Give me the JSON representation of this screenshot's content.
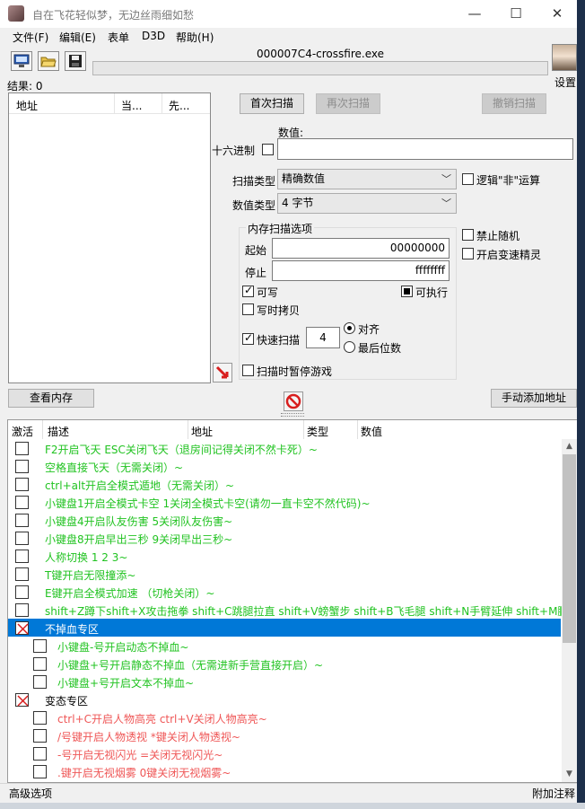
{
  "window": {
    "title": "自在飞花轻似梦，无边丝雨细如愁",
    "minimize_glyph": "—",
    "maximize_glyph": "☐",
    "close_glyph": "✕"
  },
  "menu": {
    "file": "文件(F)",
    "edit": "编辑(E)",
    "table": "表单",
    "d3d": "D3D",
    "help": "帮助(H)"
  },
  "toolbar": {
    "process_name": "000007C4-crossfire.exe",
    "settings_label": "设置",
    "icons": [
      "computer-icon",
      "open-folder-icon",
      "save-disk-icon"
    ]
  },
  "results": {
    "label": "结果: 0"
  },
  "address_list": {
    "headers": [
      "地址",
      "当...",
      "先..."
    ]
  },
  "scan": {
    "first_scan": "首次扫描",
    "next_scan": "再次扫描",
    "undo_scan": "撤销扫描",
    "value_label": "数值:",
    "hex_label": "十六进制",
    "value_input": "",
    "scan_type_label": "扫描类型",
    "scan_type_value": "精确数值",
    "value_type_label": "数值类型",
    "value_type_value": "4 字节",
    "logic_not": "逻辑\"非\"运算",
    "disable_random": "禁止随机",
    "speedhack": "开启变速精灵"
  },
  "memory_options": {
    "title": "内存扫描选项",
    "start_label": "起始",
    "start_value": "00000000",
    "stop_label": "停止",
    "stop_value": "ffffffff",
    "writable": "可写",
    "executable": "可执行",
    "copy_on_write": "写时拷贝",
    "fast_scan": "快速扫描",
    "fast_scan_value": "4",
    "align": "对齐",
    "last_digits": "最后位数",
    "pause_game": "扫描时暂停游戏"
  },
  "actions": {
    "view_memory": "查看内存",
    "add_address": "手动添加地址"
  },
  "cheat_table": {
    "headers": [
      "激活",
      "描述",
      "地址",
      "类型",
      "数值"
    ],
    "rows": [
      {
        "text": "F2开启飞天 ESC关闭飞天（退房间记得关闭不然卡死）~",
        "color": "green"
      },
      {
        "text": "空格直接飞天（无需关闭）~",
        "color": "green"
      },
      {
        "text": "ctrl+alt开启全模式遁地（无需关闭）~",
        "color": "green"
      },
      {
        "text": "小键盘1开启全模式卡空 1关闭全模式卡空(请勿一直卡空不然代码)~",
        "color": "green"
      },
      {
        "text": "小键盘4开启队友伤害  5关闭队友伤害~",
        "color": "green"
      },
      {
        "text": "小键盘8开启早出三秒 9关闭早出三秒~",
        "color": "green"
      },
      {
        "text": "人称切换 1 2 3~",
        "color": "green"
      },
      {
        "text": "T键开启无限撞添~",
        "color": "green"
      },
      {
        "text": "E键开启全模式加速 （切枪关闭）~",
        "color": "green"
      },
      {
        "text": "shift+Z蹲下shift+X攻击拖拳 shift+C跳腿拉直 shift+V螃蟹步 shift+B飞毛腿 shift+N手臂延伸 shift+M鹏地",
        "color": "green"
      },
      {
        "text": "不掉血专区",
        "color": "white",
        "group": true,
        "selected": true
      },
      {
        "text": "小键盘-号开启动态不掉血~",
        "color": "green",
        "indent": true
      },
      {
        "text": "小键盘+号开启静态不掉血（无需进新手营直接开启）~",
        "color": "green",
        "indent": true
      },
      {
        "text": "小键盘+号开启文本不掉血~",
        "color": "green",
        "indent": true
      },
      {
        "text": "变态专区",
        "color": "black",
        "group": true
      },
      {
        "text": "ctrl+C开启人物高亮 ctrl+V关闭人物高亮~",
        "color": "red",
        "indent": true
      },
      {
        "text": "/号键开启人物透视 *键关闭人物透视~",
        "color": "red",
        "indent": true
      },
      {
        "text": "-号开启无视闪光 =关闭无视闪光~",
        "color": "red",
        "indent": true
      },
      {
        "text": ".键开启无视烟雾 0键关闭无视烟雾~",
        "color": "red",
        "indent": true
      }
    ]
  },
  "status": {
    "advanced": "高级选项",
    "add_comment": "附加注释"
  },
  "colors": {
    "green": "#22c322",
    "red": "#ef5757",
    "selection": "#0078d7"
  }
}
